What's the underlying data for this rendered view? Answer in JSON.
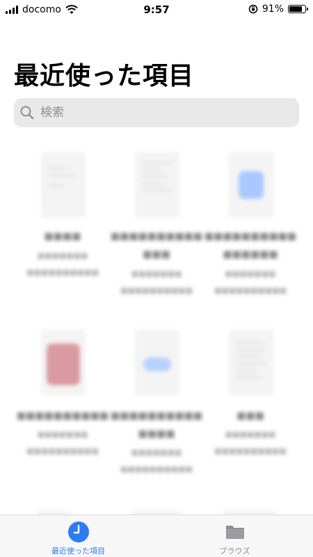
{
  "status_bar": {
    "carrier": "docomo",
    "time": "9:57",
    "battery_percent": "91%",
    "battery_level": 0.91
  },
  "page": {
    "title": "最近使った項目"
  },
  "search": {
    "placeholder": "検索"
  },
  "files": [
    {
      "name": "■■■■",
      "meta1": "■■■■■■■",
      "meta2": "■■■■■■■■■■"
    },
    {
      "name": "■■■■■■■■■■",
      "name2": "■■■",
      "meta1": "■■■■■■■",
      "meta2": "■■■■■■■■■■"
    },
    {
      "name": "■■■■■■■■■■",
      "name2": "■■■■■■",
      "meta1": "■■■■■■■",
      "meta2": "■■■■■■■■■■"
    },
    {
      "name": "■■■■■■■■■■",
      "meta1": "■■■■■■■",
      "meta2": "■■■■■■■■■■"
    },
    {
      "name": "■■■■■■■■■■",
      "name2": "■■■■",
      "meta1": "■■■■■■■",
      "meta2": "■■■■■■■■■■"
    },
    {
      "name": "■■■",
      "meta1": "■■■■■■■",
      "meta2": "■■■■■■■■■■"
    }
  ],
  "tab_bar": {
    "recent_label": "最近使った項目",
    "browse_label": "ブラウズ",
    "active_color": "#2f7bf2",
    "inactive_color": "#8e8e93"
  }
}
